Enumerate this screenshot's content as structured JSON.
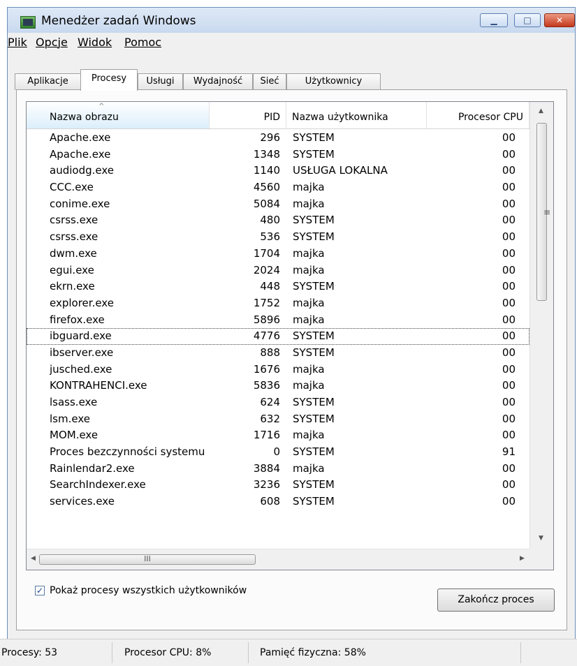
{
  "window": {
    "title": "Menedżer zadań Windows"
  },
  "menu": [
    "Plik",
    "Opcje",
    "Widok",
    "Pomoc"
  ],
  "tabs": [
    "Aplikacje",
    "Procesy",
    "Usługi",
    "Wydajność",
    "Sieć",
    "Użytkownicy"
  ],
  "active_tab": "Procesy",
  "table": {
    "headers": [
      "Nazwa obrazu",
      "PID",
      "Nazwa użytkownika",
      "Procesor CPU"
    ],
    "rows": [
      [
        "Apache.exe",
        "296",
        "SYSTEM",
        "00"
      ],
      [
        "Apache.exe",
        "1348",
        "SYSTEM",
        "00"
      ],
      [
        "audiodg.exe",
        "1140",
        "USŁUGA LOKALNA",
        "00"
      ],
      [
        "CCC.exe",
        "4560",
        "majka",
        "00"
      ],
      [
        "conime.exe",
        "5084",
        "majka",
        "00"
      ],
      [
        "csrss.exe",
        "480",
        "SYSTEM",
        "00"
      ],
      [
        "csrss.exe",
        "536",
        "SYSTEM",
        "00"
      ],
      [
        "dwm.exe",
        "1704",
        "majka",
        "00"
      ],
      [
        "egui.exe",
        "2024",
        "majka",
        "00"
      ],
      [
        "ekrn.exe",
        "448",
        "SYSTEM",
        "00"
      ],
      [
        "explorer.exe",
        "1752",
        "majka",
        "00"
      ],
      [
        "firefox.exe",
        "5896",
        "majka",
        "00"
      ],
      [
        "ibguard.exe",
        "4776",
        "SYSTEM",
        "00"
      ],
      [
        "ibserver.exe",
        "888",
        "SYSTEM",
        "00"
      ],
      [
        "jusched.exe",
        "1676",
        "majka",
        "00"
      ],
      [
        "KONTRAHENCI.exe",
        "5836",
        "majka",
        "00"
      ],
      [
        "lsass.exe",
        "624",
        "SYSTEM",
        "00"
      ],
      [
        "lsm.exe",
        "632",
        "SYSTEM",
        "00"
      ],
      [
        "MOM.exe",
        "1716",
        "majka",
        "00"
      ],
      [
        "Proces bezczynności systemu",
        "0",
        "SYSTEM",
        "91"
      ],
      [
        "Rainlendar2.exe",
        "3884",
        "majka",
        "00"
      ],
      [
        "SearchIndexer.exe",
        "3236",
        "SYSTEM",
        "00"
      ],
      [
        "services.exe",
        "608",
        "SYSTEM",
        "00"
      ]
    ],
    "focused_row": 12
  },
  "show_all_users": {
    "label": "Pokaż procesy wszystkich użytkowników",
    "checked": true
  },
  "end_process_label": "Zakończ proces",
  "status": {
    "processes": "Procesy: 53",
    "cpu": "Procesor CPU: 8%",
    "memory": "Pamięć fizyczna: 58%"
  },
  "icons": {
    "app": "task-manager-icon",
    "minimize": "minimize-icon",
    "maximize": "maximize-icon",
    "close": "close-icon",
    "sort": "sort-ascending-icon",
    "scroll_up": "scroll-up-arrow-icon",
    "scroll_down": "scroll-down-arrow-icon",
    "scroll_left": "scroll-left-arrow-icon",
    "scroll_right": "scroll-right-arrow-icon",
    "check": "checkmark-icon"
  }
}
